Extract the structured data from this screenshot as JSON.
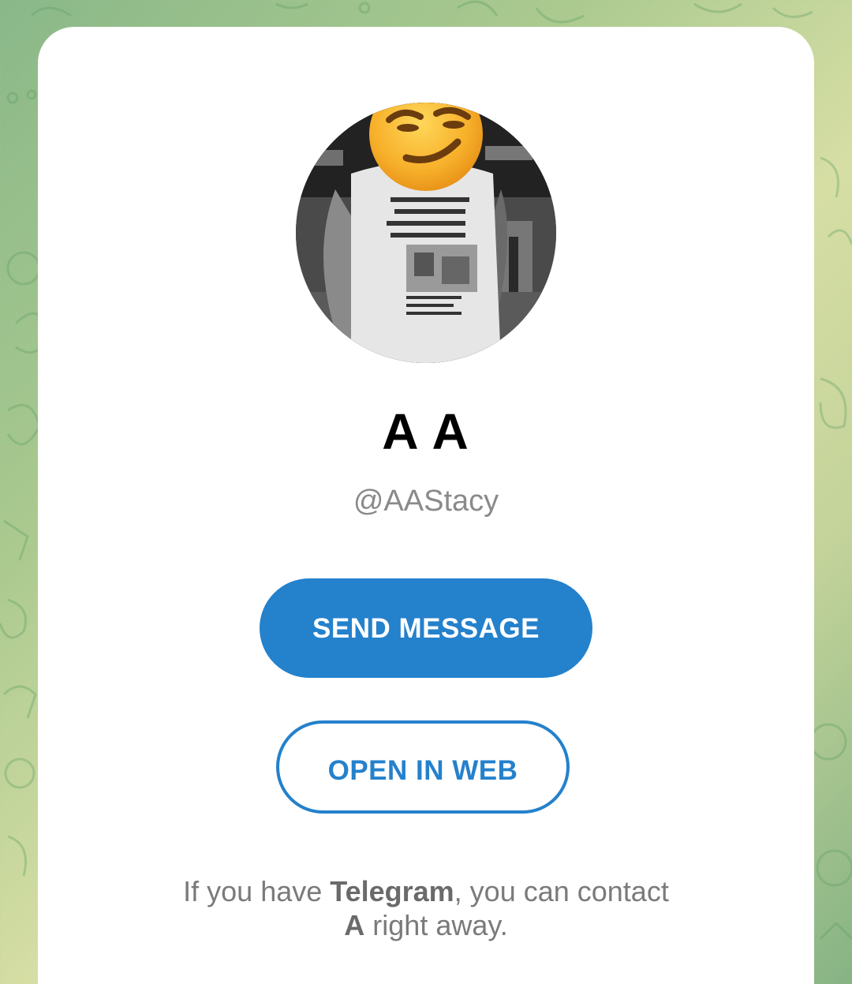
{
  "background": {
    "color_left": "#8ab889",
    "color_center": "#d6dea4"
  },
  "profile": {
    "avatar_alt": "profile photo",
    "name": "A A",
    "username": "@AAStacy"
  },
  "actions": {
    "send_message_label": "SEND MESSAGE",
    "open_in_web_label": "OPEN IN WEB"
  },
  "hint": {
    "part1": "If you have ",
    "app_name": "Telegram",
    "part2": ", you can contact",
    "contact_name": "A",
    "part3": " right away."
  },
  "colors": {
    "accent": "#2481cc",
    "card": "#ffffff",
    "secondary_text": "#8a8a8a"
  }
}
